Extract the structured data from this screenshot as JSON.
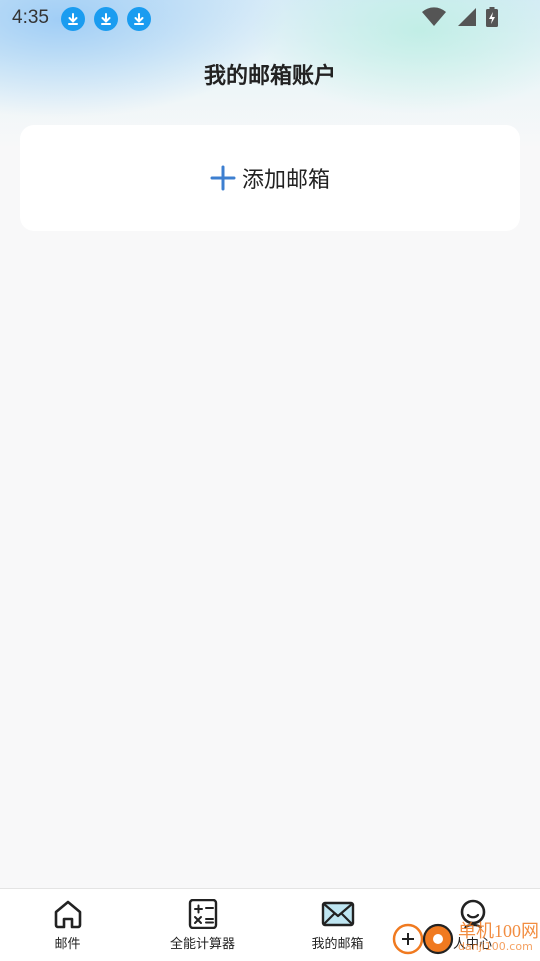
{
  "status_bar": {
    "time": "4:35",
    "download_icons": [
      "download-icon",
      "download-icon",
      "download-icon"
    ],
    "right_icons": [
      "wifi-icon",
      "cellular-signal-icon",
      "battery-charging-icon"
    ],
    "accent": "#1a9cf0"
  },
  "header": {
    "title": "我的邮箱账户"
  },
  "add_mailbox": {
    "label": "添加邮箱",
    "icon": "plus-icon",
    "icon_color": "#3d7fd0"
  },
  "bottom_nav": {
    "items": [
      {
        "label": "邮件",
        "icon": "home-icon"
      },
      {
        "label": "全能计算器",
        "icon": "calculator-icon"
      },
      {
        "label": "我的邮箱",
        "icon": "envelope-icon"
      },
      {
        "label": "人中心",
        "icon": "person-icon"
      }
    ]
  },
  "watermark": {
    "text": "单机100网",
    "sub": "danji100.com"
  }
}
